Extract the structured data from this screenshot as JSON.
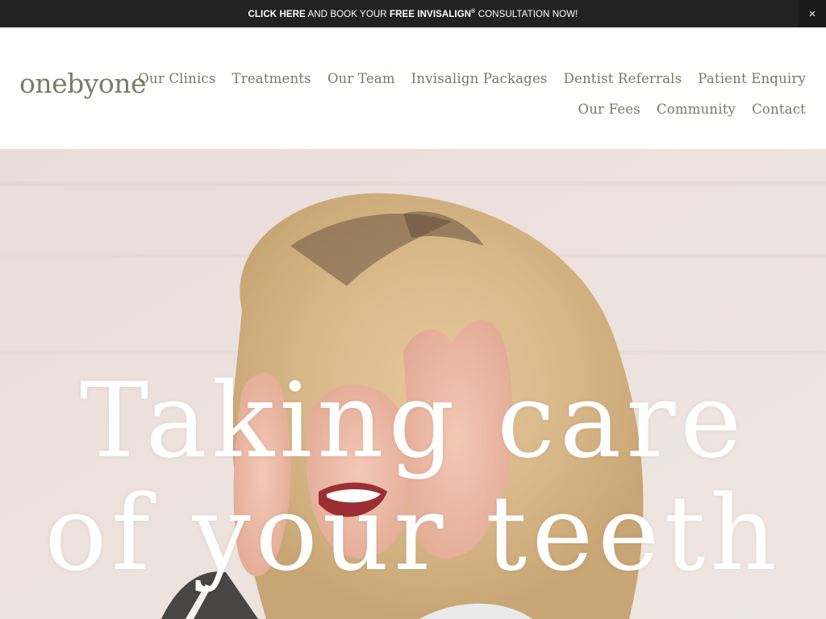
{
  "announcement": {
    "click_here": "CLICK HERE",
    "and_book": " AND BOOK YOUR ",
    "free_invisalign": "FREE INVISALIGN",
    "registered": "®",
    "consultation": " CONSULTATION NOW!",
    "close_label": "×"
  },
  "header": {
    "logo": "onebyone",
    "nav_row1": [
      "Our Clinics",
      "Treatments",
      "Our Team",
      "Invisalign Packages",
      "Dentist Referrals",
      "Patient Enquiry"
    ],
    "nav_row2": [
      "Our Fees",
      "Community",
      "Contact"
    ]
  },
  "hero": {
    "title_line1": "Taking care",
    "title_line2": "of your teeth"
  },
  "colors": {
    "announcement_bg": "#222222",
    "brand_green": "#7a7d66",
    "hero_bg": "#e8dcd8"
  }
}
